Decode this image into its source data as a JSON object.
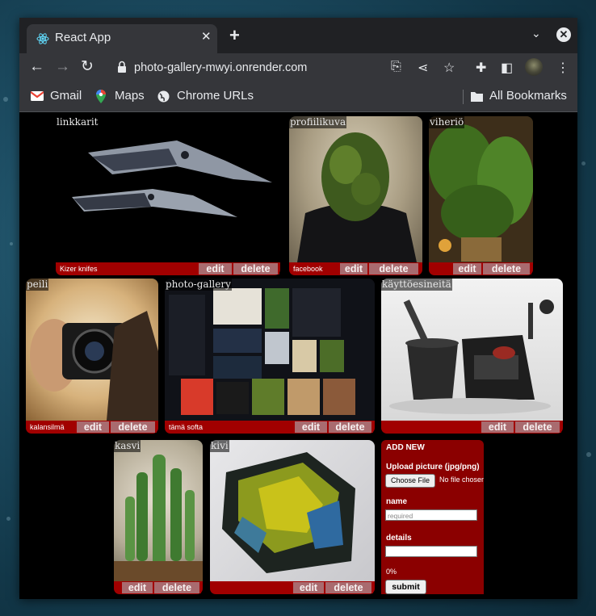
{
  "browser": {
    "tab_title": "React App",
    "url": "photo-gallery-mwyi.onrender.com",
    "bookmarks": [
      "Gmail",
      "Maps",
      "Chrome URLs",
      "All Bookmarks"
    ]
  },
  "gallery": {
    "button_edit": "edit",
    "button_delete": "delete",
    "items": [
      {
        "title": "linkkarit",
        "details": "Kizer knifes"
      },
      {
        "title": "profiilikuva",
        "details": "facebook"
      },
      {
        "title": "viheriö",
        "details": ""
      },
      {
        "title": "peili",
        "details": "kalansilmä"
      },
      {
        "title": "photo-gallery",
        "details": "tämä softa"
      },
      {
        "title": "käyttöesineitä",
        "details": ""
      },
      {
        "title": "kasvi",
        "details": ""
      },
      {
        "title": "kivi",
        "details": ""
      }
    ]
  },
  "add_new": {
    "heading": "ADD NEW",
    "upload_label": "Upload picture (jpg/png)",
    "choose_file": "Choose File",
    "no_file": "No file chosen",
    "name_label": "name",
    "name_placeholder": "required",
    "details_label": "details",
    "progress": "0%",
    "submit": "submit"
  },
  "colors": {
    "accent": "#a10000",
    "button": "#a96b6f"
  }
}
